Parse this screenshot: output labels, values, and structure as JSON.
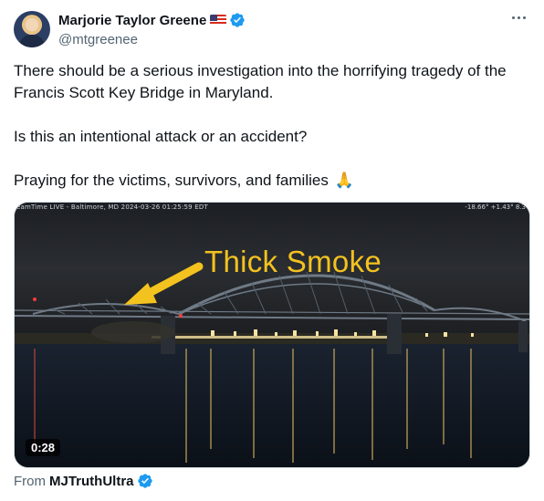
{
  "post": {
    "author": {
      "display_name": "Marjorie Taylor Greene",
      "handle": "@mtgreenee",
      "flag_icon": "us-flag-icon",
      "verified_icon": "verified-badge-icon"
    },
    "more_icon": "more-options-icon",
    "text": {
      "paragraph_1": "There should be a serious investigation into the horrifying tragedy of the Francis Scott Key Bridge in Maryland.",
      "paragraph_2": "Is this an intentional attack or an accident?",
      "paragraph_3": "Praying for the victims, survivors, and families",
      "emoji": "🙏"
    },
    "media": {
      "overlay_caption": "Thick Smoke",
      "stream_label": "eamTime LIVE - Baltimore, MD 2024-03-26 01:25:59 EDT",
      "stream_stats": "-18.66° +1.43° 8.3",
      "duration": "0:28"
    },
    "attribution": {
      "prefix": "From",
      "source_name": "MJTruthUltra",
      "verified_icon": "verified-badge-icon"
    }
  },
  "colors": {
    "text_primary": "#0f1419",
    "text_secondary": "#536471",
    "verified_blue": "#1d9bf0",
    "caption_yellow": "#f4c21f"
  }
}
